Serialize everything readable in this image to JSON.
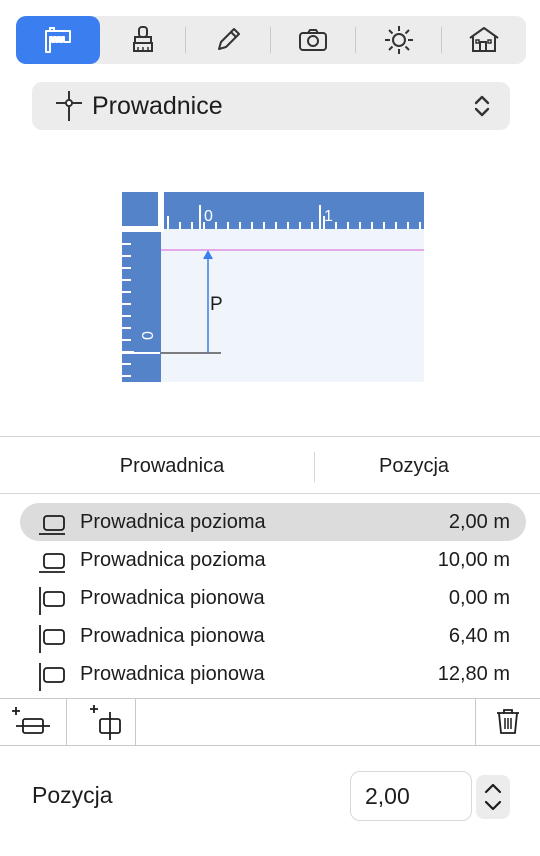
{
  "toolbar": {
    "tools": [
      {
        "name": "dimensions-tool",
        "icon": "caliper-icon",
        "active": true
      },
      {
        "name": "material-tool",
        "icon": "brush-icon",
        "active": false
      },
      {
        "name": "draw-tool",
        "icon": "pencil-icon",
        "active": false
      },
      {
        "name": "camera-tool",
        "icon": "camera-icon",
        "active": false
      },
      {
        "name": "light-tool",
        "icon": "sun-icon",
        "active": false
      },
      {
        "name": "building-tool",
        "icon": "house-icon",
        "active": false
      }
    ],
    "accent": "#3b7ef0"
  },
  "popup": {
    "label": "Prowadnice",
    "icon": "guides-icon"
  },
  "preview": {
    "ruler_top_labels": [
      "0",
      "1"
    ],
    "ruler_left_label": "0",
    "guide_letter": "P"
  },
  "table": {
    "columns": [
      "Prowadnica",
      "Pozycja"
    ],
    "rows": [
      {
        "name": "Prowadnica pozioma",
        "value": "2,00 m",
        "orientation": "horizontal",
        "selected": true
      },
      {
        "name": "Prowadnica pozioma",
        "value": "10,00 m",
        "orientation": "horizontal",
        "selected": false
      },
      {
        "name": "Prowadnica pionowa",
        "value": "0,00 m",
        "orientation": "vertical",
        "selected": false
      },
      {
        "name": "Prowadnica pionowa",
        "value": "6,40 m",
        "orientation": "vertical",
        "selected": false
      },
      {
        "name": "Prowadnica pionowa",
        "value": "12,80 m",
        "orientation": "vertical",
        "selected": false
      }
    ]
  },
  "bottom_bar": {
    "add_horizontal_icon": "add-horizontal-guide-icon",
    "add_vertical_icon": "add-vertical-guide-icon",
    "delete_icon": "trash-icon"
  },
  "position": {
    "label": "Pozycja",
    "value": "2,00"
  }
}
